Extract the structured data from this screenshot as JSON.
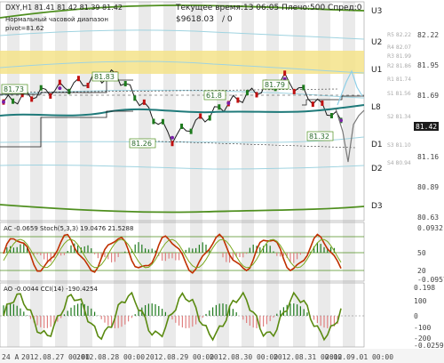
{
  "colors": {
    "background": "#ffffff",
    "stripe": "#d8d8d8",
    "frame": "#3a8a3a",
    "price": "#1a1a1a",
    "ma_teal": "#1f7a7a",
    "band_green": "#4f8f1f",
    "band_light": "#9fd3e0",
    "resistance_zone": "#f4e38a",
    "candle_up": "#1d7a1d",
    "candle_down": "#c01010",
    "ac_line": "#c03000",
    "stoch_line": "#7aa81e",
    "cci_line": "#5a8a10",
    "ao_bar": "#e08080"
  },
  "header": {
    "symbol_line": "DXY,H1  81.41 81.42 81.39 81.42",
    "server_time": "Текущее время:13 06:05 Плечо:500 Спред:0",
    "balance": "$9618.03",
    "balance_suffix": "/ 0",
    "range_label_1": "Нормальный часовой диапазон",
    "pivot_label": "pivot=81.62"
  },
  "levels": [
    {
      "label": "U3",
      "value": "82.40"
    },
    {
      "label": "U2",
      "value": "82.12"
    },
    {
      "label": "U1",
      "value": "81.85"
    },
    {
      "label": "L8",
      "value": "81.52"
    },
    {
      "label": "D1",
      "value": "81.29"
    },
    {
      "label": "D2",
      "value": "81.05"
    },
    {
      "label": "D3",
      "value": "80.72"
    }
  ],
  "axis_ticks": [
    "82.22",
    "81.95",
    "81.69",
    "81.42",
    "81.16",
    "80.89",
    "80.63"
  ],
  "axis_ticks_faint": [
    "R5 82.22",
    "R4 82.07",
    "R3 81.99",
    "R2 81.86",
    "R1 81.74",
    "S1 81.56",
    "S2 81.34",
    "S3 81.10",
    "S4 80.94"
  ],
  "price_labels": [
    {
      "text": "81.73"
    },
    {
      "text": "81.83"
    },
    {
      "text": "61.8"
    },
    {
      "text": "81.79"
    },
    {
      "text": "81.26"
    },
    {
      "text": "81.32"
    }
  ],
  "current_price": "81.42",
  "sub1": {
    "label": "AC -0.0659   Stoch(5,3,3) 19.0476 21.5288",
    "ticks": [
      "0.0932",
      "50",
      "20",
      "-0.0957"
    ]
  },
  "sub2": {
    "label": "AO -0.0044  CCI(14) -190.4254",
    "ticks": [
      "0.198",
      "100",
      "0",
      "-100",
      "-200",
      "-0.0259"
    ]
  },
  "time_axis": [
    "24 A",
    "2012.08.27 00:00",
    "2012.08.28 00:00",
    "2012.08.29 00:00",
    "2012.08.30 00:00",
    "2012.08.31 00:00",
    "2012.09.01 00:00"
  ],
  "chart_data": {
    "type": "line",
    "title": "DXY,H1",
    "ylim": [
      80.55,
      82.45
    ],
    "x": [
      "2012.08.24",
      "2012.08.27",
      "2012.08.28",
      "2012.08.29",
      "2012.08.30",
      "2012.08.31",
      "2012.09.01"
    ],
    "series": [
      {
        "name": "DXY",
        "values": [
          81.58,
          81.7,
          81.82,
          81.27,
          81.57,
          81.78,
          81.42
        ]
      }
    ]
  }
}
